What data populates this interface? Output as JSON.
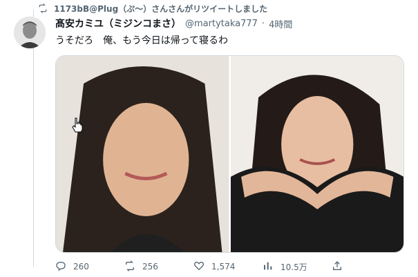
{
  "retweet": {
    "text": "1173bB@Plug（ぷ〜）さんさんがリツイートしました",
    "icon": "retweet-icon"
  },
  "tweet": {
    "display_name": "髙安カミユ（ミジンコまさ）",
    "handle": "@martytaka777",
    "dot": "·",
    "time": "4時間",
    "text": "うそだろ　俺、もう今日は帰って寝るわ",
    "media": [
      {
        "icon": "photo-left"
      },
      {
        "icon": "photo-right"
      }
    ]
  },
  "actions": {
    "reply_count": "260",
    "retweet_count": "256",
    "like_count": "1,574",
    "views_count": "10.5万"
  },
  "colors": {
    "text": "#0f1419",
    "muted": "#536471",
    "border": "#cfd9de"
  }
}
